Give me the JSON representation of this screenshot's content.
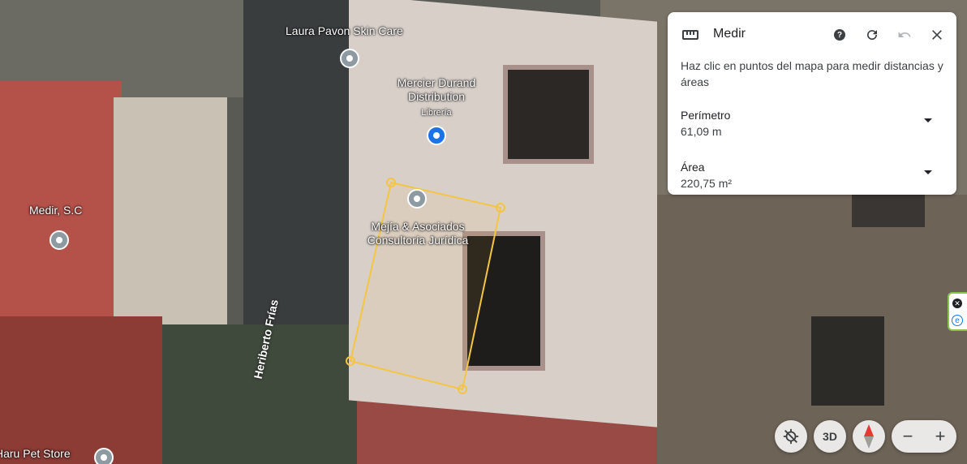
{
  "map": {
    "places": [
      {
        "name": "Laura Pavon Skin Care"
      },
      {
        "name": "Mercier Durand Distribution",
        "category": "Librería"
      },
      {
        "name": "Mejía & Asociados Consultoría Jurídica"
      },
      {
        "name": "Medir, S.C"
      },
      {
        "name": "Haru Pet Store"
      }
    ],
    "street": "Heriberto Frías"
  },
  "panel": {
    "title": "Medir",
    "description": "Haz clic en puntos del mapa para medir distancias y áreas",
    "perimeter": {
      "label": "Perímetro",
      "value": "61,09 m"
    },
    "area": {
      "label": "Área",
      "value": "220,75 m²"
    },
    "icons": {
      "tool": "ruler-icon",
      "help": "help-icon",
      "reset": "refresh-icon",
      "undo": "undo-icon",
      "close": "close-icon"
    }
  },
  "controls": {
    "view_3d": "3D",
    "zoom_out": "−",
    "zoom_in": "+"
  },
  "colors": {
    "measure_line": "#f4c542",
    "accent": "#1a73e8",
    "compass_red": "#e53935"
  }
}
